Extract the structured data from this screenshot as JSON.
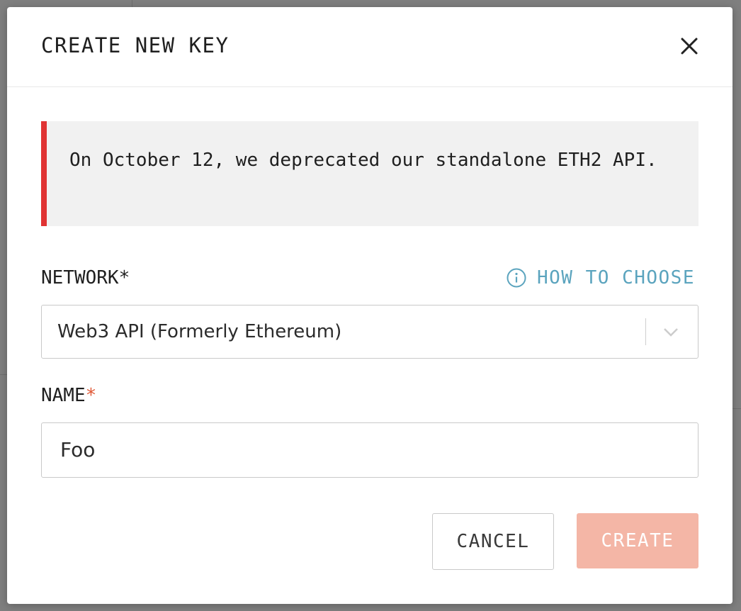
{
  "modal": {
    "title": "CREATE NEW KEY",
    "notice": "On October 12, we deprecated our standalone ETH2 API."
  },
  "network": {
    "label": "NETWORK",
    "required_mark": "*",
    "help_link": "HOW TO CHOOSE",
    "selected_value": "Web3 API (Formerly Ethereum)"
  },
  "name": {
    "label": "NAME",
    "required_mark": "*",
    "value": "Foo"
  },
  "buttons": {
    "cancel": "CANCEL",
    "create": "CREATE"
  },
  "icons": {
    "close": "close-icon",
    "info": "info-icon",
    "chevron": "chevron-down-icon"
  },
  "colors": {
    "alert_bar": "#e03333",
    "link": "#5ba4be",
    "required_accent": "#e05a38",
    "create_button_disabled": "#f4b6a6"
  }
}
